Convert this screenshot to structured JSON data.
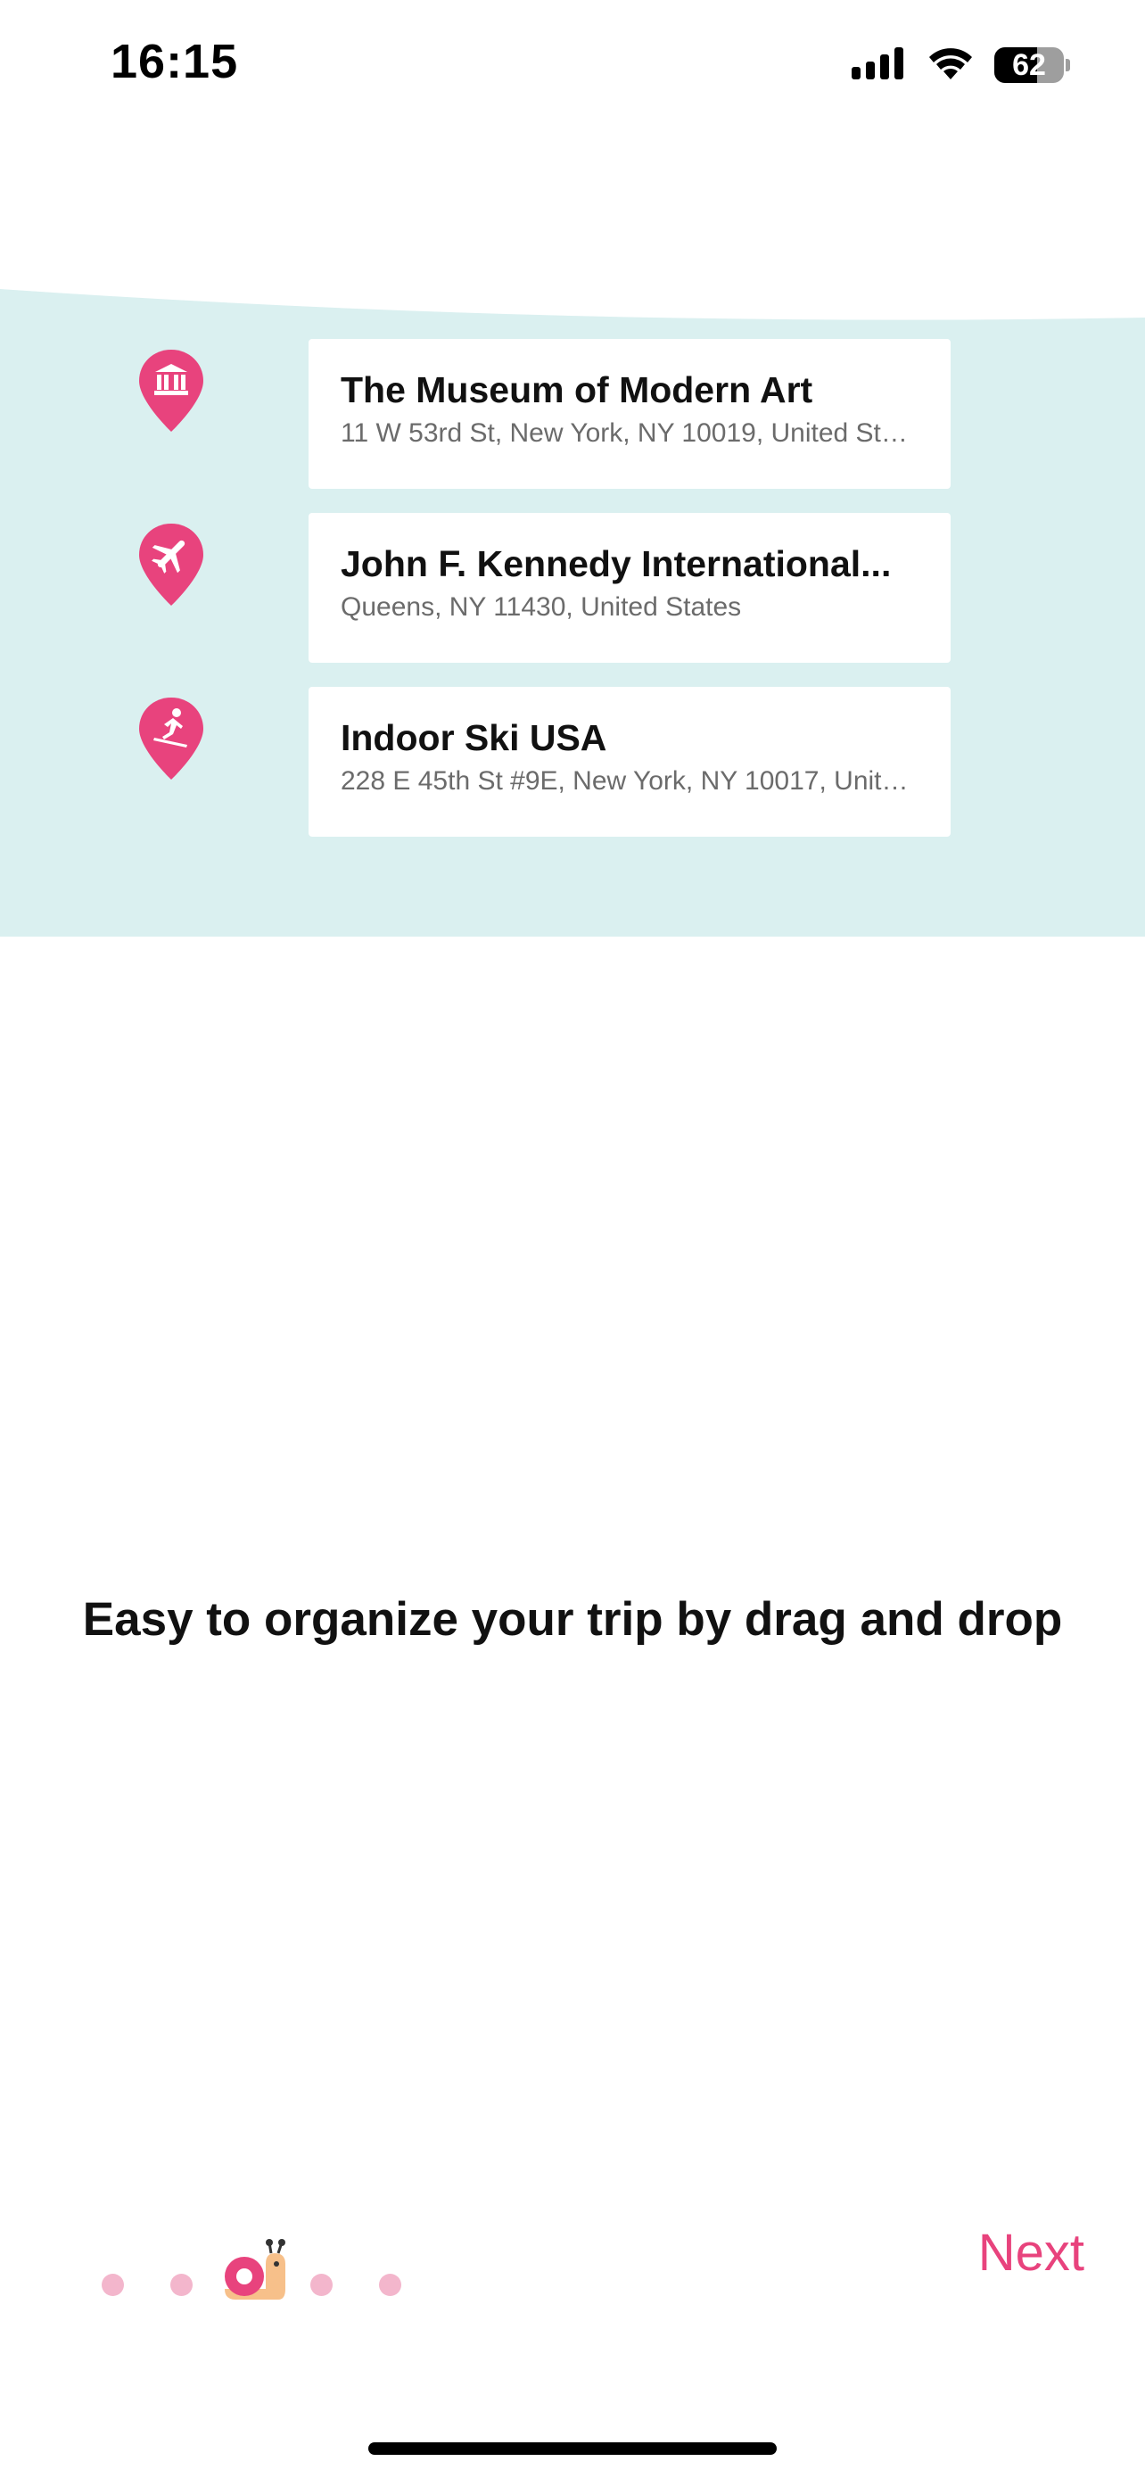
{
  "status_bar": {
    "time": "16:15",
    "battery_level": "62",
    "icons": [
      "signal-icon",
      "wifi-icon",
      "battery-icon"
    ]
  },
  "places": [
    {
      "icon": "museum-icon",
      "title": "The Museum of Modern Art",
      "address": "11 W 53rd St, New York, NY 10019, United States"
    },
    {
      "icon": "airplane-icon",
      "title": "John F. Kennedy International...",
      "address": "Queens, NY 11430, United States"
    },
    {
      "icon": "skier-icon",
      "title": "Indoor Ski USA",
      "address": "228 E 45th St #9E, New York, NY 10017, United..."
    }
  ],
  "onboarding": {
    "headline": "Easy to organize your trip by drag and drop",
    "next_label": "Next",
    "page_count": 5,
    "current_page": 3,
    "current_indicator_icon": "snail-icon"
  },
  "colors": {
    "accent": "#e8437d",
    "teal_band": "#daf0f0",
    "dot_inactive": "#f3b6cc"
  }
}
